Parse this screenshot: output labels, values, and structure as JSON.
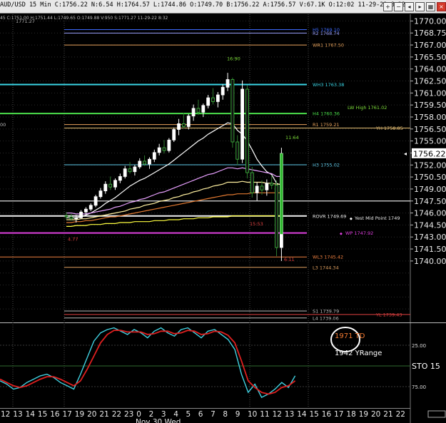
{
  "header": {
    "text": "AUD/USD 15 Min C:1756.22 N:6.54 H:1764.57 L:1744.86 O:1749.70 B:1756.22 A:1756.57 V:67.1K O:12:02 11-29-22 8:32",
    "icons": [
      "zoom-in-icon",
      "zoom-out-icon",
      "scroll-left-icon",
      "scroll-right-icon",
      "tile-icon",
      "close-icon"
    ]
  },
  "chart_data": [
    {
      "type": "candlestick",
      "y_ticks": [
        1770.0,
        1768.75,
        1767.5,
        1766.25,
        1765.0,
        1763.75,
        1762.5,
        1761.25,
        1760.0,
        1758.75,
        1757.5,
        1756.25,
        1755.0,
        1753.75,
        1752.5,
        1751.25,
        1750.0,
        1748.75,
        1747.5,
        1746.25,
        1745.0,
        1743.75,
        1742.5,
        1741.25,
        1740.0
      ],
      "y_tick_labels": [
        "1770.00",
        "1768.75",
        "1767.00",
        "1765.50",
        "1764.00",
        "1762.50",
        "1761.00",
        "1759.50",
        "1758.00",
        "1756.50",
        "1755.00",
        "1753.50",
        "1752.00",
        "1750.50",
        "1749.00",
        "1747.50",
        "1746.00",
        "1744.50",
        "1743.00",
        "1741.50",
        "1740.00"
      ],
      "last_price_tag": "1756.22",
      "left_partial_labels": [
        "1771.27",
        "45 C:1751.00 H:1751.44 L:1749.65 O:1749.88 V:950 S:1771.27 11-29-22 8:32",
        "00"
      ],
      "level_lines": [
        {
          "label": "H5 1769.10",
          "price": 1769.1,
          "color": "#3d6bff"
        },
        {
          "label": "R2 1768.74",
          "price": 1768.74,
          "color": "#9aa0ff"
        },
        {
          "label": "WR1 1767.50",
          "price": 1767.5,
          "color": "#e8a35c"
        },
        {
          "label": "WH3 1763.38",
          "price": 1763.38,
          "color": "#3ad6e6"
        },
        {
          "label": "H4 1760.36",
          "price": 1760.36,
          "color": "#4ce04c"
        },
        {
          "label": "LW High 1761.02",
          "price": 1761.02,
          "color": "#7ddc3a"
        },
        {
          "label": "R1 1759.21",
          "price": 1759.21,
          "color": "#e8a35c"
        },
        {
          "label": "YH 1758.85",
          "price": 1758.85,
          "color": "#e8c074"
        },
        {
          "label": "H3 1755.02",
          "price": 1755.02,
          "color": "#5ec7e6"
        },
        {
          "label": "ROVR 1749.69",
          "price": 1749.69,
          "color": "#f0f0f0"
        },
        {
          "label": "Yest Mid Point 1749",
          "price": 1749.5,
          "color": "#e8e8e8"
        },
        {
          "label": "WP 1747.92",
          "price": 1747.92,
          "color": "#e040e0"
        },
        {
          "label": "WL3 1745.42",
          "price": 1745.42,
          "color": "#f08040"
        },
        {
          "label": "L3 1744.34",
          "price": 1744.34,
          "color": "#e0a060"
        },
        {
          "label": "S1 1739.79",
          "price": 1739.79,
          "color": "#bbbbbb"
        },
        {
          "label": "L4 1739.06",
          "price": 1739.06,
          "color": "#bbbbbb"
        },
        {
          "label": "YL 1739.43",
          "price": 1739.43,
          "color": "#e04040"
        }
      ],
      "annotations": [
        {
          "text": "16:90",
          "color": "#7ddc3a"
        },
        {
          "text": "11:64",
          "color": "#7ddc3a"
        },
        {
          "text": "4.77",
          "color": "#e04040"
        },
        {
          "text": "15:53",
          "color": "#e04040"
        },
        {
          "text": "6:11",
          "color": "#e04040"
        }
      ],
      "candles": [
        [
          1749.7,
          1750.1,
          1749.3,
          1749.6
        ],
        [
          1749.6,
          1749.9,
          1749.2,
          1749.4
        ],
        [
          1749.4,
          1749.8,
          1749.0,
          1749.5
        ],
        [
          1749.5,
          1750.3,
          1749.4,
          1750.1
        ],
        [
          1750.1,
          1750.6,
          1749.8,
          1750.4
        ],
        [
          1750.4,
          1751.0,
          1750.2,
          1750.8
        ],
        [
          1750.8,
          1751.9,
          1750.6,
          1751.7
        ],
        [
          1751.7,
          1752.6,
          1751.5,
          1752.3
        ],
        [
          1752.3,
          1753.3,
          1752.0,
          1753.0
        ],
        [
          1753.0,
          1753.8,
          1752.4,
          1752.7
        ],
        [
          1752.7,
          1753.6,
          1752.4,
          1753.4
        ],
        [
          1753.4,
          1754.1,
          1753.1,
          1753.8
        ],
        [
          1753.8,
          1754.9,
          1753.6,
          1754.6
        ],
        [
          1754.6,
          1755.3,
          1754.1,
          1754.3
        ],
        [
          1754.3,
          1755.0,
          1753.9,
          1754.8
        ],
        [
          1754.8,
          1755.7,
          1754.6,
          1755.4
        ],
        [
          1755.4,
          1756.0,
          1754.9,
          1755.1
        ],
        [
          1755.1,
          1755.8,
          1754.6,
          1755.6
        ],
        [
          1755.6,
          1756.6,
          1755.3,
          1756.3
        ],
        [
          1756.3,
          1757.2,
          1756.0,
          1756.8
        ],
        [
          1756.8,
          1757.6,
          1756.2,
          1756.5
        ],
        [
          1756.5,
          1757.8,
          1756.3,
          1757.6
        ],
        [
          1757.6,
          1758.9,
          1757.4,
          1758.7
        ],
        [
          1758.7,
          1759.8,
          1758.1,
          1759.3
        ],
        [
          1759.3,
          1760.4,
          1758.8,
          1759.0
        ],
        [
          1759.0,
          1760.3,
          1758.7,
          1760.1
        ],
        [
          1760.1,
          1761.3,
          1759.6,
          1760.9
        ],
        [
          1760.9,
          1761.8,
          1760.2,
          1760.5
        ],
        [
          1760.5,
          1761.4,
          1760.0,
          1761.2
        ],
        [
          1761.2,
          1762.3,
          1760.9,
          1762.0
        ],
        [
          1762.0,
          1763.0,
          1761.3,
          1761.6
        ],
        [
          1761.6,
          1762.6,
          1761.0,
          1762.3
        ],
        [
          1762.3,
          1763.4,
          1761.8,
          1763.1
        ],
        [
          1763.1,
          1764.6,
          1762.7,
          1763.9
        ],
        [
          1763.9,
          1764.1,
          1756.8,
          1757.4
        ],
        [
          1757.4,
          1758.1,
          1755.0,
          1755.6
        ],
        [
          1755.6,
          1763.8,
          1755.2,
          1762.9
        ],
        [
          1762.9,
          1763.3,
          1753.6,
          1754.2
        ],
        [
          1754.2,
          1754.8,
          1751.6,
          1752.1
        ],
        [
          1752.1,
          1753.2,
          1751.3,
          1752.8
        ],
        [
          1752.8,
          1753.4,
          1751.9,
          1752.4
        ],
        [
          1752.4,
          1753.5,
          1751.8,
          1753.1
        ],
        [
          1753.1,
          1753.9,
          1752.5,
          1752.9
        ],
        [
          1752.9,
          1753.4,
          1745.5,
          1746.4
        ],
        [
          1746.4,
          1756.8,
          1745.0,
          1756.2
        ]
      ],
      "moving_averages": [
        {
          "color": "#ffffff",
          "values": [
            1749.5,
            1749.5,
            1749.5,
            1749.6,
            1749.8,
            1750.0,
            1750.3,
            1750.6,
            1751.0,
            1751.3,
            1751.6,
            1752.0,
            1752.4,
            1752.8,
            1753.1,
            1753.4,
            1753.6,
            1753.9,
            1754.2,
            1754.5,
            1754.8,
            1755.1,
            1755.5,
            1755.9,
            1756.3,
            1756.7,
            1757.1,
            1757.5,
            1757.8,
            1758.2,
            1758.5,
            1758.8,
            1759.1,
            1759.4,
            1759.3,
            1758.6,
            1758.2,
            1757.5,
            1756.6,
            1755.6,
            1754.9,
            1754.3,
            1754.0,
            1753.1,
            1752.9
          ]
        },
        {
          "color": "#e8a0ff",
          "values": [
            1750.0,
            1750.0,
            1749.9,
            1749.9,
            1749.9,
            1750.0,
            1750.1,
            1750.2,
            1750.3,
            1750.4,
            1750.6,
            1750.7,
            1750.9,
            1751.1,
            1751.2,
            1751.4,
            1751.5,
            1751.7,
            1751.9,
            1752.1,
            1752.2,
            1752.4,
            1752.6,
            1752.8,
            1753.0,
            1753.2,
            1753.4,
            1753.6,
            1753.8,
            1754.0,
            1754.1,
            1754.3,
            1754.5,
            1754.7,
            1754.7,
            1754.6,
            1754.7,
            1754.6,
            1754.5,
            1754.4,
            1754.3,
            1754.2,
            1754.1,
            1753.8,
            1753.8
          ]
        },
        {
          "color": "#fff0a0",
          "values": [
            1749.3,
            1749.3,
            1749.3,
            1749.4,
            1749.4,
            1749.5,
            1749.6,
            1749.7,
            1749.8,
            1749.9,
            1750.0,
            1750.1,
            1750.2,
            1750.4,
            1750.5,
            1750.6,
            1750.8,
            1750.9,
            1751.0,
            1751.2,
            1751.3,
            1751.4,
            1751.6,
            1751.7,
            1751.9,
            1752.0,
            1752.2,
            1752.3,
            1752.5,
            1752.6,
            1752.8,
            1752.9,
            1753.0,
            1753.2,
            1753.2,
            1753.2,
            1753.3,
            1753.2,
            1753.2,
            1753.2,
            1753.2,
            1753.1,
            1753.1,
            1753.0,
            1753.0
          ]
        },
        {
          "color": "#e07830",
          "values": [
            1749.0,
            1749.0,
            1749.1,
            1749.1,
            1749.2,
            1749.2,
            1749.3,
            1749.4,
            1749.5,
            1749.6,
            1749.6,
            1749.7,
            1749.8,
            1749.9,
            1750.0,
            1750.1,
            1750.2,
            1750.3,
            1750.4,
            1750.5,
            1750.6,
            1750.7,
            1750.8,
            1750.9,
            1751.0,
            1751.1,
            1751.2,
            1751.3,
            1751.4,
            1751.5,
            1751.6,
            1751.7,
            1751.8,
            1751.9,
            1751.9,
            1752.0,
            1752.0,
            1752.0,
            1752.1,
            1752.1,
            1752.1,
            1752.1,
            1752.1,
            1752.1,
            1752.1
          ]
        },
        {
          "color": "#ffff40",
          "values": [
            1748.6,
            1748.6,
            1748.7,
            1748.7,
            1748.7,
            1748.8,
            1748.8,
            1748.8,
            1748.9,
            1748.9,
            1748.9,
            1749.0,
            1749.0,
            1749.0,
            1749.1,
            1749.1,
            1749.1,
            1749.1,
            1749.2,
            1749.2,
            1749.2,
            1749.3,
            1749.3,
            1749.3,
            1749.4,
            1749.4,
            1749.4,
            1749.5,
            1749.5,
            1749.5,
            1749.6,
            1749.6,
            1749.6,
            1749.6,
            1749.7,
            1749.7,
            1749.7,
            1749.7,
            1749.7,
            1749.7,
            1749.7,
            1749.7,
            1749.7,
            1749.7,
            1749.7
          ]
        }
      ]
    },
    {
      "type": "line",
      "indicator": "STO 15",
      "y_ticks": [
        25.0,
        75.0
      ],
      "y_tick_labels": [
        "25.00",
        "75.00"
      ],
      "label": "STO 15",
      "annotations": [
        "1971 TD",
        "1942 YRange"
      ],
      "series": [
        {
          "color": "#40d0e0",
          "values": [
            68,
            72,
            78,
            76,
            70,
            66,
            62,
            60,
            64,
            70,
            74,
            78,
            60,
            40,
            20,
            10,
            6,
            4,
            8,
            12,
            6,
            10,
            16,
            8,
            4,
            10,
            14,
            6,
            4,
            10,
            16,
            8,
            6,
            12,
            18,
            30,
            60,
            82,
            72,
            88,
            84,
            78,
            70,
            76,
            62
          ]
        },
        {
          "color": "#e02020",
          "values": [
            66,
            70,
            74,
            76,
            74,
            70,
            66,
            63,
            63,
            66,
            70,
            74,
            68,
            54,
            38,
            22,
            12,
            7,
            7,
            9,
            9,
            9,
            12,
            11,
            8,
            8,
            11,
            10,
            7,
            8,
            12,
            11,
            8,
            9,
            13,
            22,
            44,
            68,
            76,
            82,
            84,
            82,
            76,
            74,
            68
          ]
        }
      ]
    }
  ],
  "x_axis": {
    "tick_labels": [
      "12",
      "13",
      "14",
      "15",
      "16",
      "17",
      "19",
      "20",
      "21",
      "22",
      "23",
      "0",
      "2",
      "3",
      "4",
      "5",
      "6",
      "7",
      "8",
      "9",
      "10",
      "11",
      "12",
      "13",
      "14",
      "15",
      "16",
      "17",
      "18",
      "19",
      "20",
      "21",
      "22"
    ],
    "date_label": "Nov 30 Wed"
  },
  "colors": {
    "background": "#000000",
    "up_candle": "#ffffff",
    "down_candle": "#000000"
  }
}
